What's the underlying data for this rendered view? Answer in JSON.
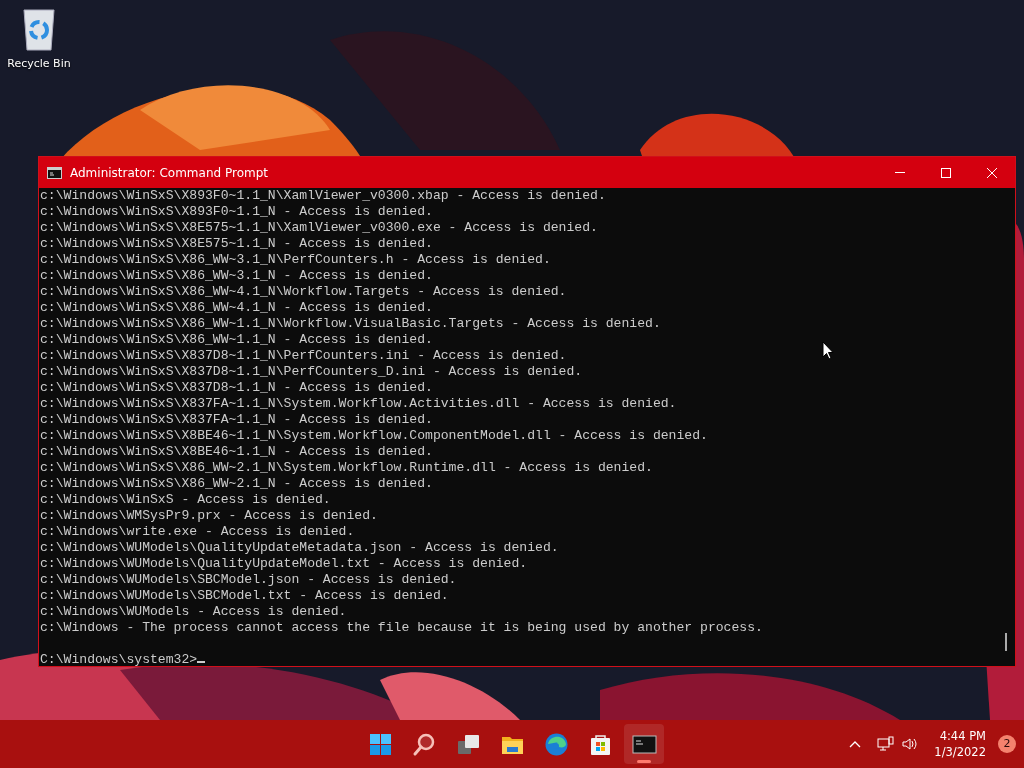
{
  "desktop_icons": [
    {
      "label": "Recycle Bin"
    }
  ],
  "window": {
    "title": "Administrator: Command Prompt",
    "lines": [
      "c:\\Windows\\WinSxS\\X893F0~1.1_N\\XamlViewer_v0300.xbap - Access is denied.",
      "c:\\Windows\\WinSxS\\X893F0~1.1_N - Access is denied.",
      "c:\\Windows\\WinSxS\\X8E575~1.1_N\\XamlViewer_v0300.exe - Access is denied.",
      "c:\\Windows\\WinSxS\\X8E575~1.1_N - Access is denied.",
      "c:\\Windows\\WinSxS\\X86_WW~3.1_N\\PerfCounters.h - Access is denied.",
      "c:\\Windows\\WinSxS\\X86_WW~3.1_N - Access is denied.",
      "c:\\Windows\\WinSxS\\X86_WW~4.1_N\\Workflow.Targets - Access is denied.",
      "c:\\Windows\\WinSxS\\X86_WW~4.1_N - Access is denied.",
      "c:\\Windows\\WinSxS\\X86_WW~1.1_N\\Workflow.VisualBasic.Targets - Access is denied.",
      "c:\\Windows\\WinSxS\\X86_WW~1.1_N - Access is denied.",
      "c:\\Windows\\WinSxS\\X837D8~1.1_N\\PerfCounters.ini - Access is denied.",
      "c:\\Windows\\WinSxS\\X837D8~1.1_N\\PerfCounters_D.ini - Access is denied.",
      "c:\\Windows\\WinSxS\\X837D8~1.1_N - Access is denied.",
      "c:\\Windows\\WinSxS\\X837FA~1.1_N\\System.Workflow.Activities.dll - Access is denied.",
      "c:\\Windows\\WinSxS\\X837FA~1.1_N - Access is denied.",
      "c:\\Windows\\WinSxS\\X8BE46~1.1_N\\System.Workflow.ComponentModel.dll - Access is denied.",
      "c:\\Windows\\WinSxS\\X8BE46~1.1_N - Access is denied.",
      "c:\\Windows\\WinSxS\\X86_WW~2.1_N\\System.Workflow.Runtime.dll - Access is denied.",
      "c:\\Windows\\WinSxS\\X86_WW~2.1_N - Access is denied.",
      "c:\\Windows\\WinSxS - Access is denied.",
      "c:\\Windows\\WMSysPr9.prx - Access is denied.",
      "c:\\Windows\\write.exe - Access is denied.",
      "c:\\Windows\\WUModels\\QualityUpdateMetadata.json - Access is denied.",
      "c:\\Windows\\WUModels\\QualityUpdateModel.txt - Access is denied.",
      "c:\\Windows\\WUModels\\SBCModel.json - Access is denied.",
      "c:\\Windows\\WUModels\\SBCModel.txt - Access is denied.",
      "c:\\Windows\\WUModels - Access is denied.",
      "c:\\Windows - The process cannot access the file because it is being used by another process."
    ],
    "prompt": "C:\\Windows\\system32>"
  },
  "taskbar": {
    "apps": [
      {
        "kind": "start",
        "active": false
      },
      {
        "kind": "search",
        "active": false
      },
      {
        "kind": "task-view",
        "active": false
      },
      {
        "kind": "folder",
        "active": false
      },
      {
        "kind": "browser",
        "active": false
      },
      {
        "kind": "store",
        "active": false
      },
      {
        "kind": "terminal",
        "active": true
      }
    ],
    "time": "4:44 PM",
    "date": "1/3/2022",
    "notifications": "2"
  }
}
